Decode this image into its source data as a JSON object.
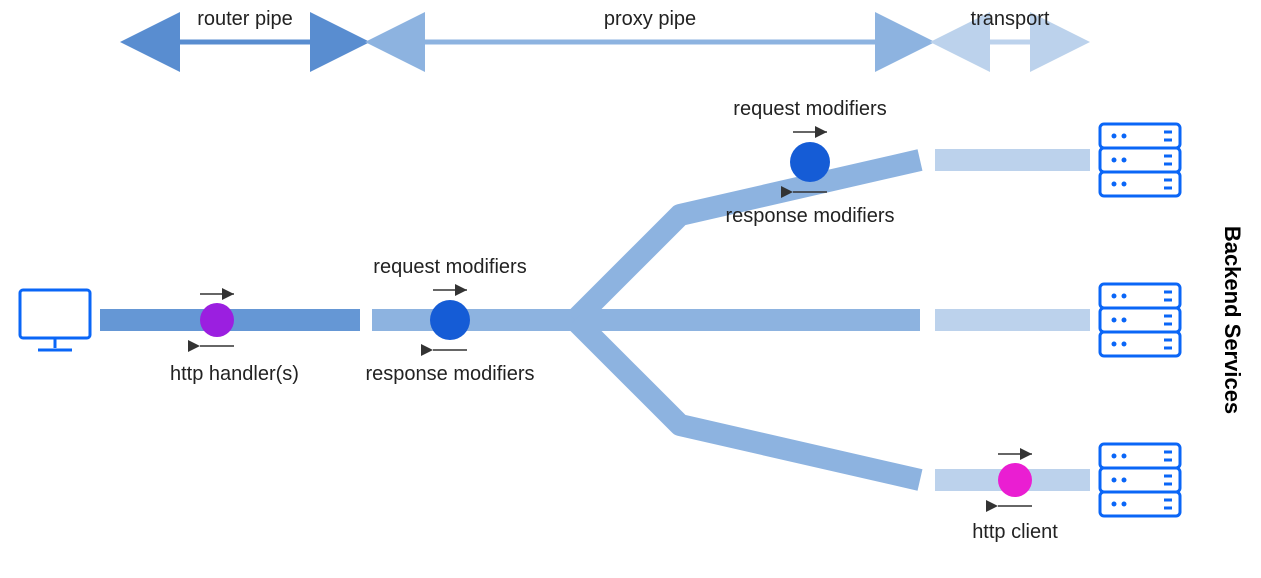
{
  "sections": {
    "router": "router pipe",
    "proxy": "proxy pipe",
    "transport": "transport"
  },
  "nodes": {
    "http_handlers": "http handler(s)",
    "req_mod_main": "request modifiers",
    "resp_mod_main": "response modifiers",
    "req_mod_branch": "request modifiers",
    "resp_mod_branch": "response modifiers",
    "http_client": "http client"
  },
  "side_label": "Backend Services",
  "colors": {
    "pipe_router": "#6597d5",
    "pipe_proxy": "#8db3e0",
    "pipe_transport": "#bcd2ec",
    "dot_purple": "#9b1fe0",
    "dot_blue": "#155cd6",
    "dot_magenta": "#ea1ed2",
    "outline_blue": "#0a66f7",
    "header_arrow1": "#598dd0",
    "header_arrow2": "#8db3e0",
    "header_arrow3": "#bcd2ec"
  }
}
